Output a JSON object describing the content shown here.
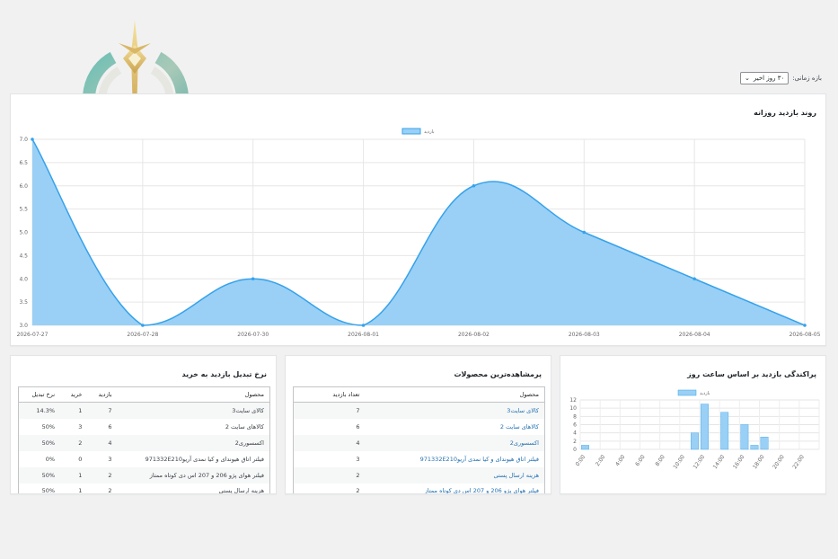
{
  "filter": {
    "label": "بازه زمانی:",
    "selected": "۳۰ روز اخیر"
  },
  "main_chart": {
    "title": "روند بازدید روزانه",
    "legend": "بازدید",
    "color": "#36a2eb",
    "fill": "#9ad0f5"
  },
  "hour_chart": {
    "title": "پراکندگی بازدید بر اساس ساعت روز",
    "legend": "بازدید",
    "color": "#9ad0f5"
  },
  "conversion": {
    "title": "نرخ تبدیل بازدید به خرید",
    "headers": [
      "محصول",
      "بازدید",
      "خرید",
      "نرخ تبدیل"
    ],
    "rows": [
      [
        "کالای سایت3",
        "7",
        "1",
        "14.3%"
      ],
      [
        "کالاهای سایت 2",
        "6",
        "3",
        "50%"
      ],
      [
        "اکسسوری2",
        "4",
        "2",
        "50%"
      ],
      [
        "فیلتر اتاق هیوندای و کیا نمدی آریو971332E210",
        "3",
        "0",
        "0%"
      ],
      [
        "فیلتر هوای پژو 206 و 207 اس دی کوتاه ممتاز",
        "2",
        "1",
        "50%"
      ],
      [
        "هزینه ارسال پستی",
        "2",
        "1",
        "50%"
      ]
    ]
  },
  "top_products": {
    "title": "پرمشاهده‌ترین محصولات",
    "headers": [
      "محصول",
      "تعداد بازدید"
    ],
    "rows": [
      [
        "کالای سایت3",
        "7"
      ],
      [
        "کالاهای سایت 2",
        "6"
      ],
      [
        "اکسسوری2",
        "4"
      ],
      [
        "فیلتر اتاق هیوندای و کیا نمدی آریو971332E210",
        "3"
      ],
      [
        "هزینه ارسال پستی",
        "2"
      ],
      [
        "فیلتر هوای پژو 206 و 207 اس دی کوتاه ممتاز",
        "2"
      ]
    ]
  },
  "chart_data": [
    {
      "type": "area",
      "title": "روند بازدید روزانه",
      "x": [
        "2026-07-27",
        "2026-07-28",
        "2026-07-30",
        "2026-08-01",
        "2026-08-02",
        "2026-08-03",
        "2026-08-04",
        "2026-08-05"
      ],
      "series": [
        {
          "name": "بازدید",
          "values": [
            7,
            3,
            4,
            3,
            6,
            5,
            4,
            3
          ]
        }
      ],
      "ylim": [
        3,
        7
      ],
      "yticks": [
        "3.0",
        "3.5",
        "4.0",
        "4.5",
        "5.0",
        "5.5",
        "6.0",
        "6.5",
        "7.0"
      ],
      "grid": true,
      "legend": "top"
    },
    {
      "type": "bar",
      "title": "پراکندگی بازدید بر اساس ساعت روز",
      "categories": [
        "0:00",
        "1:00",
        "2:00",
        "3:00",
        "4:00",
        "5:00",
        "6:00",
        "7:00",
        "8:00",
        "9:00",
        "10:00",
        "11:00",
        "12:00",
        "13:00",
        "14:00",
        "15:00",
        "16:00",
        "17:00",
        "18:00",
        "19:00",
        "20:00",
        "21:00",
        "22:00",
        "23:00"
      ],
      "tick_labels": [
        "0:00",
        "2:00",
        "4:00",
        "6:00",
        "8:00",
        "10:00",
        "12:00",
        "14:00",
        "16:00",
        "18:00",
        "20:00",
        "22:00"
      ],
      "series": [
        {
          "name": "بازدید",
          "values": [
            1,
            0,
            0,
            0,
            0,
            0,
            0,
            0,
            0,
            0,
            0,
            4,
            11,
            0,
            9,
            0,
            6,
            1,
            3,
            0,
            0,
            0,
            0,
            0
          ]
        }
      ],
      "ylim": [
        0,
        12
      ],
      "yticks": [
        "0",
        "2",
        "4",
        "6",
        "8",
        "10",
        "12"
      ],
      "grid": true,
      "legend": "top"
    }
  ]
}
